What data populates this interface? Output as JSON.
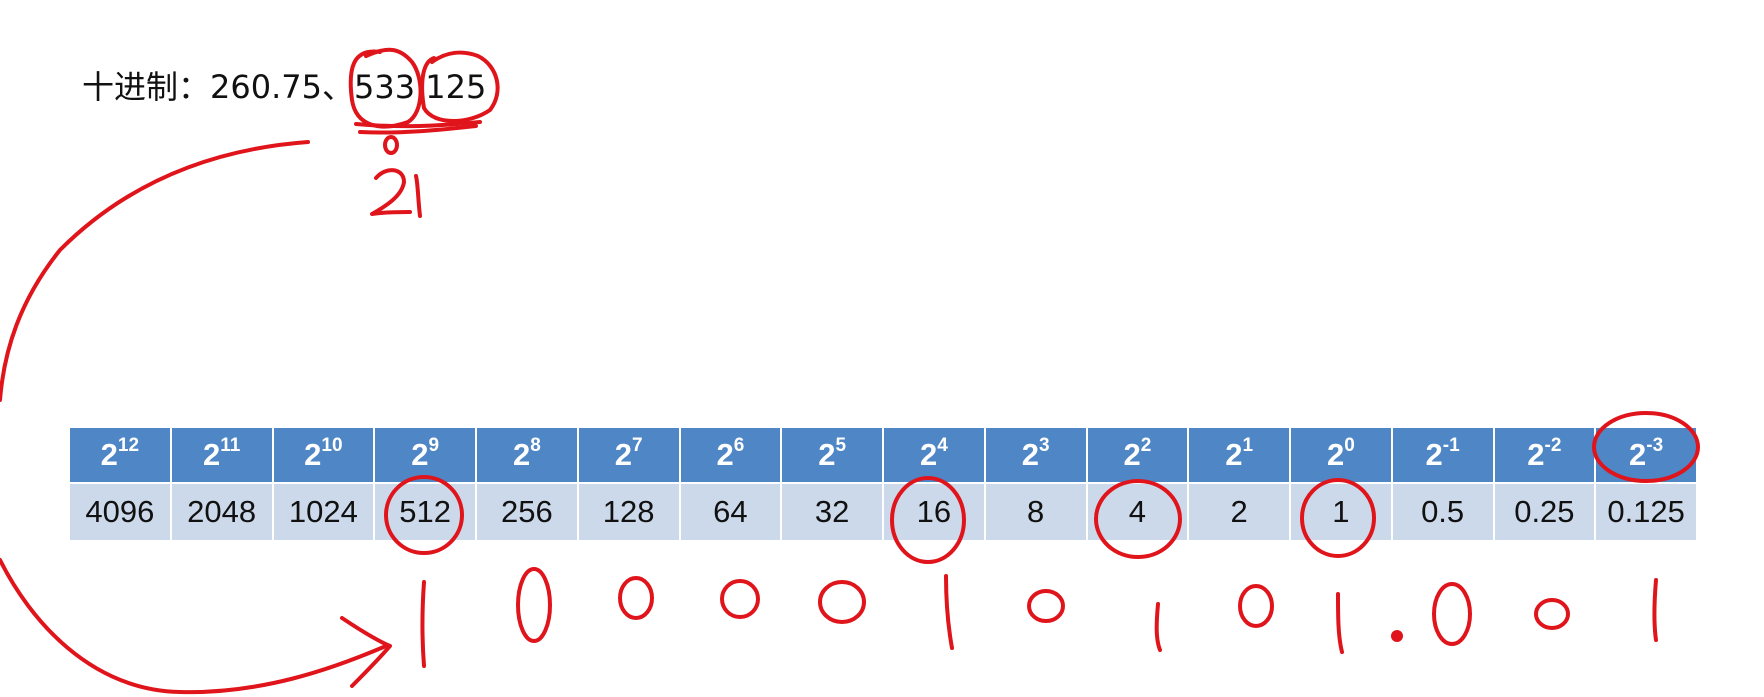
{
  "title": {
    "label": "十进制：",
    "numbers": "260.75、533.125"
  },
  "table": {
    "powers": [
      {
        "base": "2",
        "exp": "12"
      },
      {
        "base": "2",
        "exp": "11"
      },
      {
        "base": "2",
        "exp": "10"
      },
      {
        "base": "2",
        "exp": "9"
      },
      {
        "base": "2",
        "exp": "8"
      },
      {
        "base": "2",
        "exp": "7"
      },
      {
        "base": "2",
        "exp": "6"
      },
      {
        "base": "2",
        "exp": "5"
      },
      {
        "base": "2",
        "exp": "4"
      },
      {
        "base": "2",
        "exp": "3"
      },
      {
        "base": "2",
        "exp": "2"
      },
      {
        "base": "2",
        "exp": "1"
      },
      {
        "base": "2",
        "exp": "0"
      },
      {
        "base": "2",
        "exp": "-1"
      },
      {
        "base": "2",
        "exp": "-2"
      },
      {
        "base": "2",
        "exp": "-3"
      }
    ],
    "values": [
      "4096",
      "2048",
      "1024",
      "512",
      "256",
      "128",
      "64",
      "32",
      "16",
      "8",
      "4",
      "2",
      "1",
      "0.5",
      "0.25",
      "0.125"
    ]
  },
  "annotations": {
    "color": "#e0141b",
    "handwritten_remainder": "21",
    "handwritten_binary": "1000010101.001",
    "circled_values": [
      "533",
      "125",
      "512",
      "16",
      "4",
      "1",
      "2^-3"
    ]
  },
  "colors": {
    "header_bg": "#4e86c6",
    "value_bg": "#ccd9ea"
  }
}
